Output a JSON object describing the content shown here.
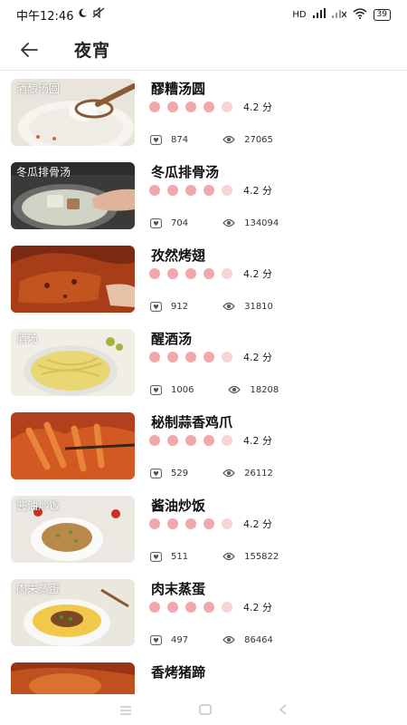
{
  "status": {
    "time": "中午12:46",
    "net_label": "HD",
    "battery": "39"
  },
  "header": {
    "title": "夜宵"
  },
  "items": [
    {
      "title": "醪糟汤圆",
      "score": "4.2 分",
      "favorites": "874",
      "views": "27065",
      "caption": "酒酿汤圆"
    },
    {
      "title": "冬瓜排骨汤",
      "score": "4.2 分",
      "favorites": "704",
      "views": "134094",
      "caption": "冬瓜排骨汤"
    },
    {
      "title": "孜然烤翅",
      "score": "4.2 分",
      "favorites": "912",
      "views": "31810",
      "caption": ""
    },
    {
      "title": "醒酒汤",
      "score": "4.2 分",
      "favorites": "1006",
      "views": "18208",
      "caption": "酒汤"
    },
    {
      "title": "秘制蒜香鸡爪",
      "score": "4.2 分",
      "favorites": "529",
      "views": "26112",
      "caption": ""
    },
    {
      "title": "酱油炒饭",
      "score": "4.2 分",
      "favorites": "511",
      "views": "155822",
      "caption": "酱油炒饭"
    },
    {
      "title": "肉末蒸蛋",
      "score": "4.2 分",
      "favorites": "497",
      "views": "86464",
      "caption": "肉末蒸蛋"
    },
    {
      "title": "香烤猪蹄",
      "score": "",
      "favorites": "",
      "views": "",
      "caption": ""
    }
  ],
  "rating_level": 0.8
}
